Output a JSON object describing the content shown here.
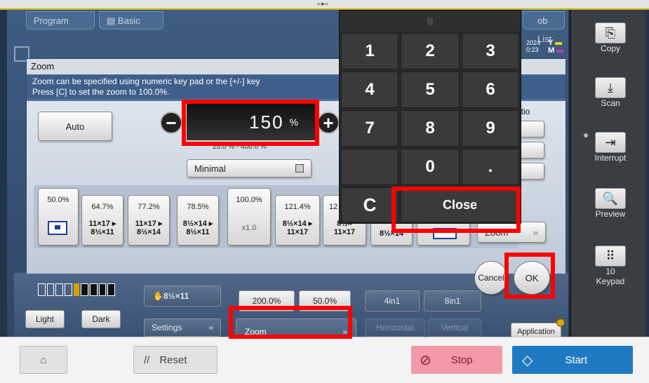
{
  "top_tabs": {
    "program": "Program",
    "basic": "Basic",
    "job_list": "ob List"
  },
  "clock": {
    "year": "2024",
    "time": "0:23"
  },
  "toner": {
    "y": "Y",
    "m": "M"
  },
  "dialog": {
    "title": "Zoom",
    "desc_line1": "Zoom can be specified using numeric key pad or the [+/-] key",
    "desc_line2": "Press [C] to set the zoom to 100.0%.",
    "auto_label": "Auto",
    "minus_label": "−",
    "plus_label": "+",
    "zoom_value": "150",
    "zoom_unit": "%",
    "range_text": "25.0 % - 400.0 %",
    "minimal_label": "Minimal",
    "ratio_label": "atio",
    "presets": [
      {
        "pct": "50.0%",
        "paper": ""
      },
      {
        "pct": "64.7%",
        "paper": "11×17 ▸\n8½×11"
      },
      {
        "pct": "77.2%",
        "paper": "11×17 ▸\n8½×14"
      },
      {
        "pct": "78.5%",
        "paper": "8½×14 ▸\n8½×11"
      },
      {
        "pct": "100.0%",
        "paper": "x1.0"
      },
      {
        "pct": "121.4%",
        "paper": "8½×14 ▸\n11×17"
      },
      {
        "pct": "12",
        "paper": "8½×\n11×17"
      },
      {
        "pct": "",
        "paper": "8½×14"
      }
    ],
    "zoom_label": "Zoom",
    "cancel_label": "Cancel",
    "ok_label": "OK"
  },
  "keypad": {
    "handle": "|||",
    "keys": [
      "1",
      "2",
      "3",
      "4",
      "5",
      "6",
      "7",
      "8",
      "9",
      "",
      "0",
      "."
    ],
    "clear_label": "C",
    "close_label": "Close"
  },
  "bottom": {
    "light_label": "Light",
    "dark_label": "Dark",
    "settings_label": "Settings",
    "paper_label": "8½×11",
    "zoom_200": "200.0%",
    "zoom_50": "50.0%",
    "zoom_label": "Zoom",
    "four_in_one": "4in1",
    "eight_in_one": "8in1",
    "horizontal": "Horizontal",
    "vertical": "Vertical",
    "application": "Application"
  },
  "sidebar": {
    "copy": "Copy",
    "scan": "Scan",
    "interrupt": "Interrupt",
    "preview": "Preview",
    "keypad_count": "10",
    "keypad_label": "Keypad"
  },
  "footer": {
    "reset": "Reset",
    "stop": "Stop",
    "start": "Start"
  },
  "colors": {
    "start": "#1f7ac2",
    "stop": "#f49aa6",
    "highlight": "#ff0000"
  }
}
